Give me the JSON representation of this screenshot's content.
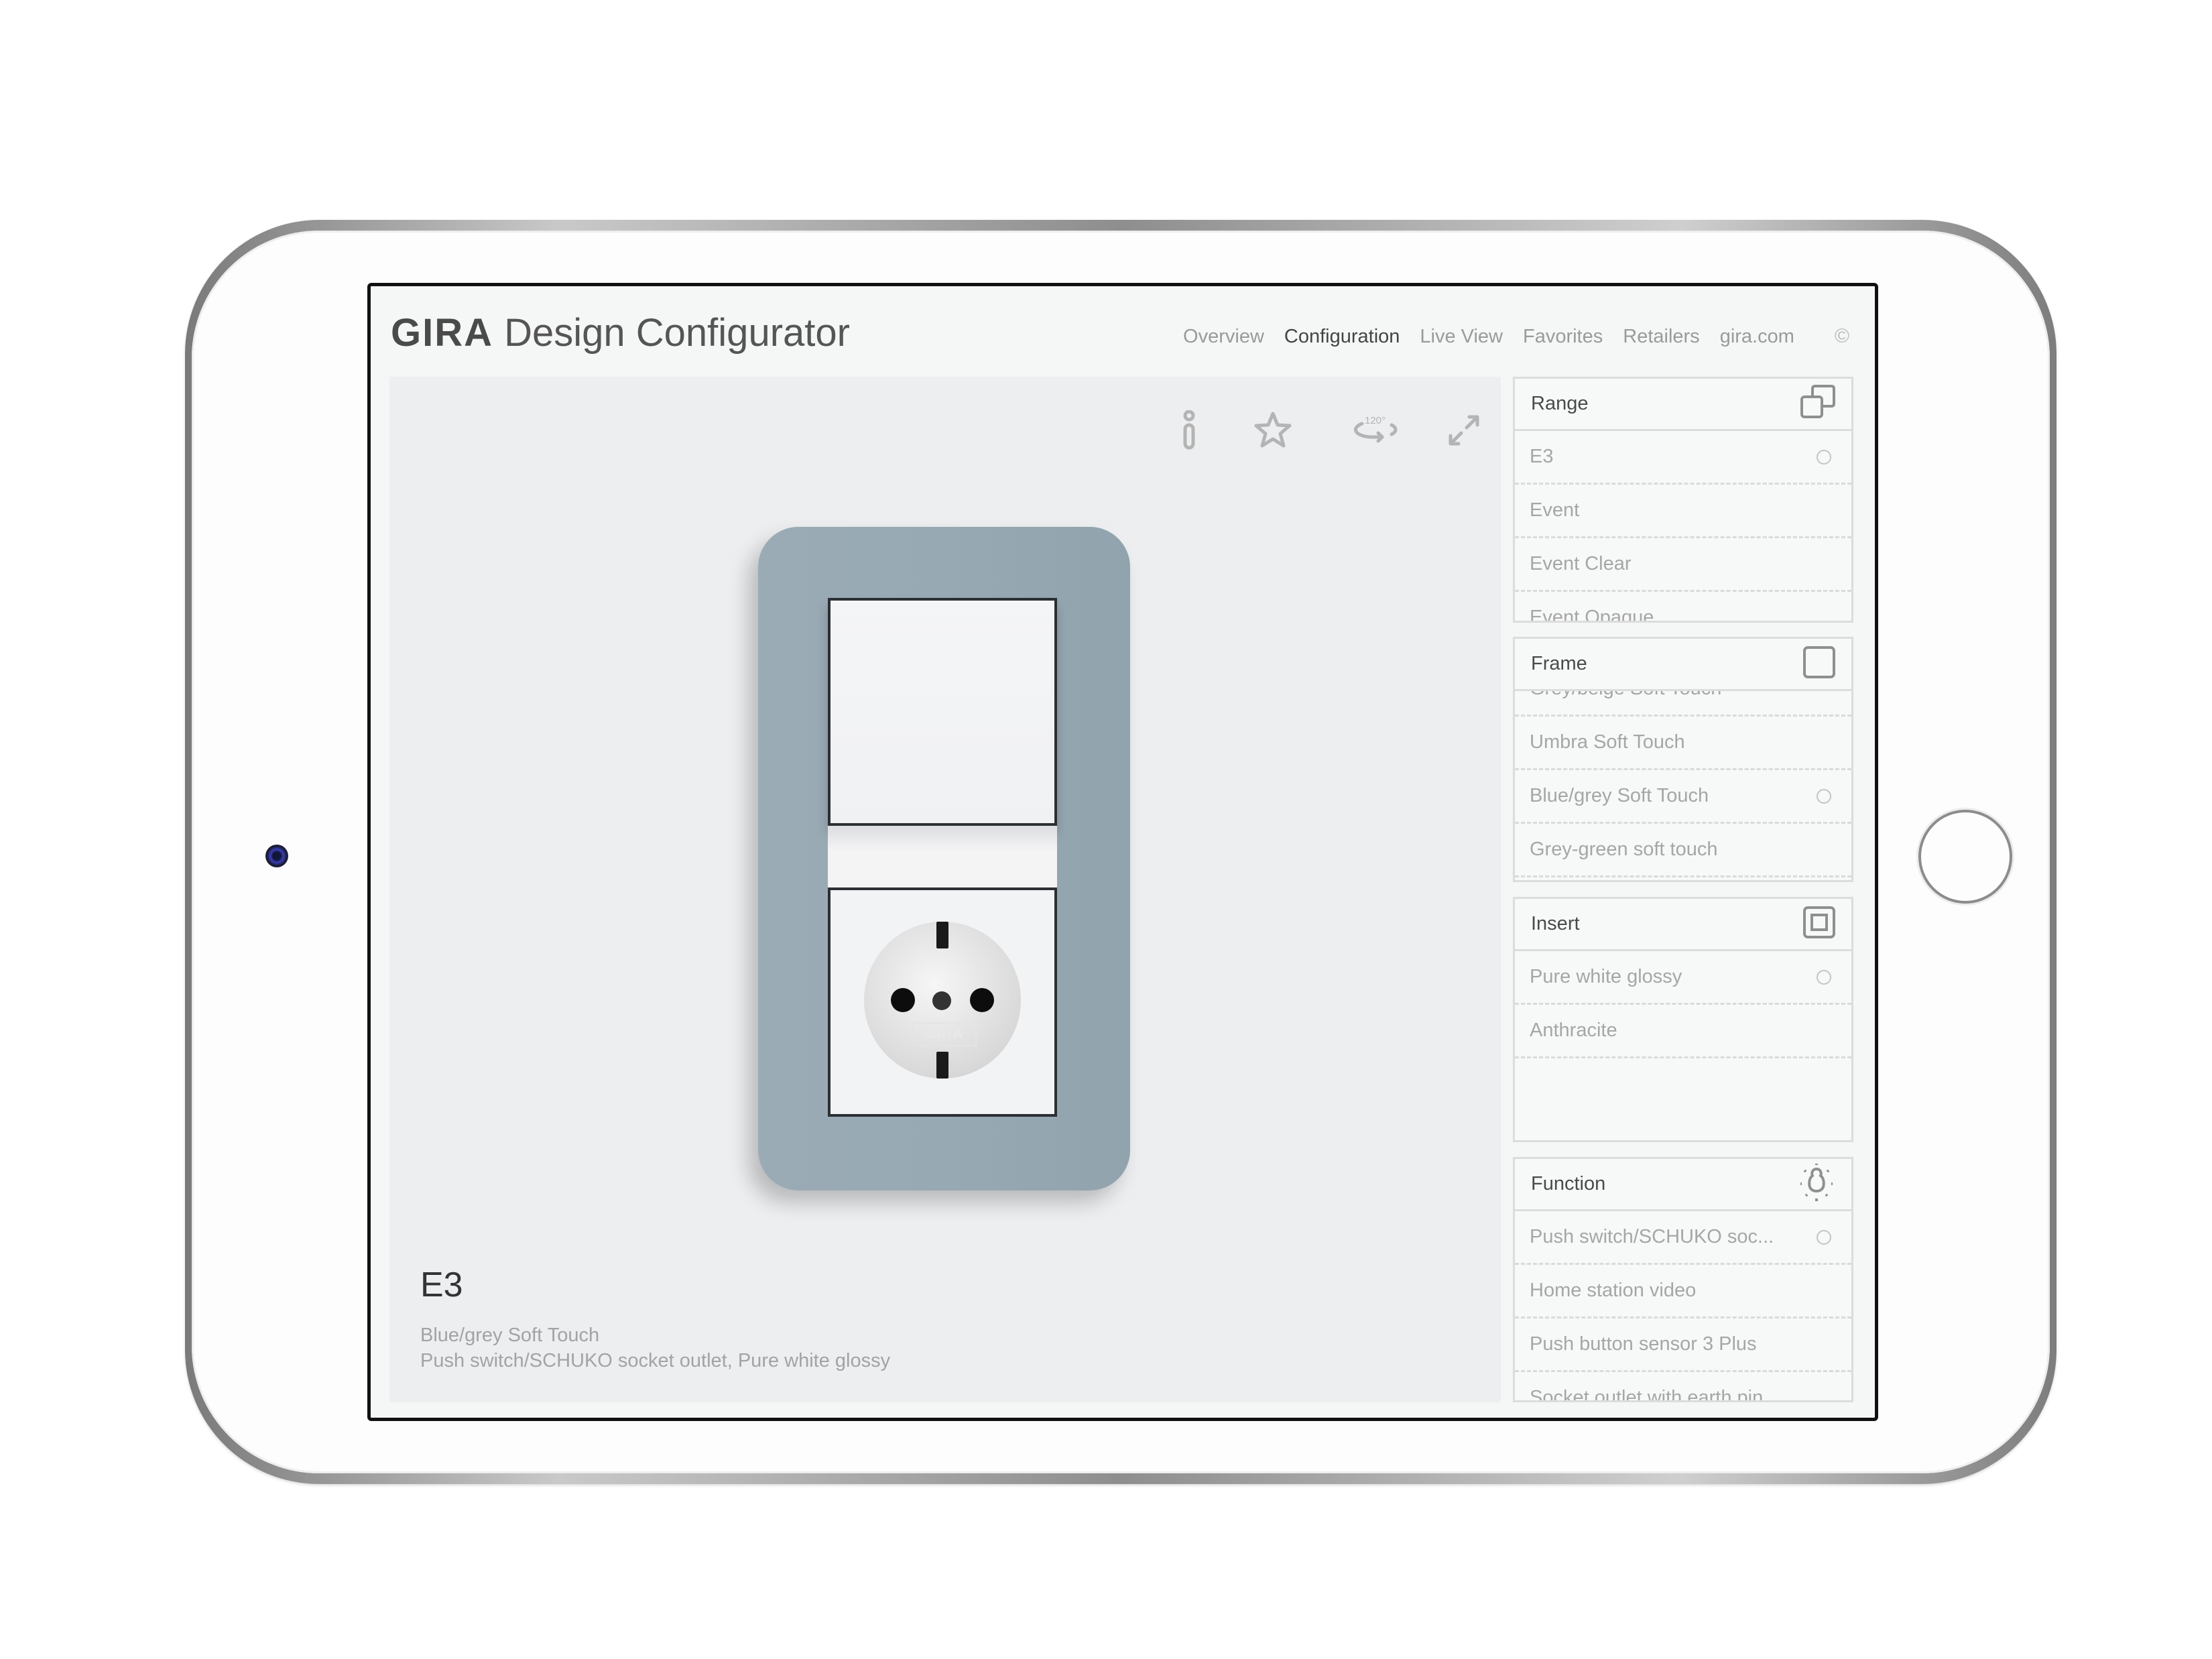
{
  "app": {
    "brand": "GIRA",
    "title": "Design Configurator"
  },
  "nav": {
    "items": [
      {
        "label": "Overview",
        "active": false
      },
      {
        "label": "Configuration",
        "active": true
      },
      {
        "label": "Live View",
        "active": false
      },
      {
        "label": "Favorites",
        "active": false
      },
      {
        "label": "Retailers",
        "active": false
      },
      {
        "label": "gira.com",
        "active": false
      }
    ],
    "copyright_symbol": "©"
  },
  "toolbar": {
    "icons": [
      "info-icon",
      "star-icon",
      "rotate-120-icon",
      "expand-icon"
    ],
    "rotate_label": "120°"
  },
  "product": {
    "name": "E3",
    "frame": "Blue/grey Soft Touch",
    "details": "Push switch/SCHUKO socket outlet, Pure white glossy",
    "frame_color": "#97a9b3",
    "socket_logo": "GIRA"
  },
  "panel": {
    "range": {
      "title": "Range",
      "icon": "range-icon",
      "options": [
        {
          "label": "E3",
          "selected": true
        },
        {
          "label": "Event",
          "selected": false
        },
        {
          "label": "Event Clear",
          "selected": false
        },
        {
          "label": "Event Opaque",
          "selected": false
        }
      ]
    },
    "frame": {
      "title": "Frame",
      "icon": "frame-icon",
      "options": [
        {
          "label": "Grey/beige Soft Touch",
          "selected": false
        },
        {
          "label": "Umbra Soft Touch",
          "selected": false
        },
        {
          "label": "Blue/grey Soft Touch",
          "selected": true
        },
        {
          "label": "Grey-green soft touch",
          "selected": false
        }
      ]
    },
    "insert": {
      "title": "Insert",
      "icon": "insert-icon",
      "options": [
        {
          "label": "Pure white glossy",
          "selected": true
        },
        {
          "label": "Anthracite",
          "selected": false
        }
      ]
    },
    "function": {
      "title": "Function",
      "icon": "bulb-icon",
      "options": [
        {
          "label": "Push switch/SCHUKO soc...",
          "selected": true
        },
        {
          "label": "Home station video",
          "selected": false
        },
        {
          "label": "Push button sensor 3 Plus",
          "selected": false
        },
        {
          "label": "Socket outlet with earth pin",
          "selected": false
        }
      ]
    }
  }
}
